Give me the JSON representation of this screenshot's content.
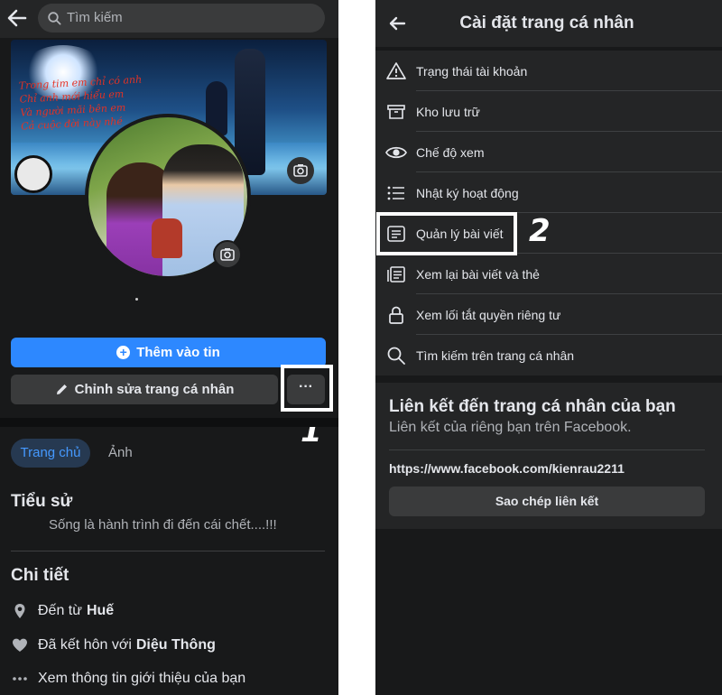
{
  "left": {
    "search_placeholder": "Tìm kiếm",
    "cover_text": [
      "Trong tim em chỉ có anh",
      "Chỉ anh mới hiểu em",
      "Và người mãi bên em",
      "Cả cuộc đời này nhé"
    ],
    "add_to_story": "Thêm vào tin",
    "edit_profile": "Chỉnh sửa trang cá nhân",
    "more_label": "···",
    "annotation": "1",
    "tabs": {
      "home": "Trang chủ",
      "photos": "Ảnh"
    },
    "bio": {
      "heading": "Tiểu sử",
      "text": "Sống là hành trình đi đến cái chết....!!!"
    },
    "details": {
      "heading": "Chi tiết",
      "from_prefix": "Đến từ",
      "from_value": "Huế",
      "married_prefix": "Đã kết hôn với",
      "married_value": "Diệu Thông",
      "see_intro": "Xem thông tin giới thiệu của bạn"
    }
  },
  "right": {
    "title": "Cài đặt trang cá nhân",
    "annotation": "2",
    "menu": [
      {
        "icon": "warning-icon",
        "label": "Trạng thái tài khoản"
      },
      {
        "icon": "archive-icon",
        "label": "Kho lưu trữ"
      },
      {
        "icon": "eye-icon",
        "label": "Chế độ xem"
      },
      {
        "icon": "list-icon",
        "label": "Nhật ký hoạt động"
      },
      {
        "icon": "post-icon",
        "label": "Quản lý bài viết"
      },
      {
        "icon": "review-icon",
        "label": "Xem lại bài viết và thẻ"
      },
      {
        "icon": "lock-icon",
        "label": "Xem lối tắt quyền riêng tư"
      },
      {
        "icon": "search-icon",
        "label": "Tìm kiếm trên trang cá nhân"
      }
    ],
    "link_section": {
      "heading": "Liên kết đến trang cá nhân của bạn",
      "subtitle": "Liên kết của riêng bạn trên Facebook.",
      "url": "https://www.facebook.com/kienrau2211",
      "copy_button": "Sao chép liên kết"
    }
  },
  "colors": {
    "accent": "#2d88ff",
    "background": "#18191a",
    "surface": "#242526",
    "button": "#3a3b3c"
  }
}
